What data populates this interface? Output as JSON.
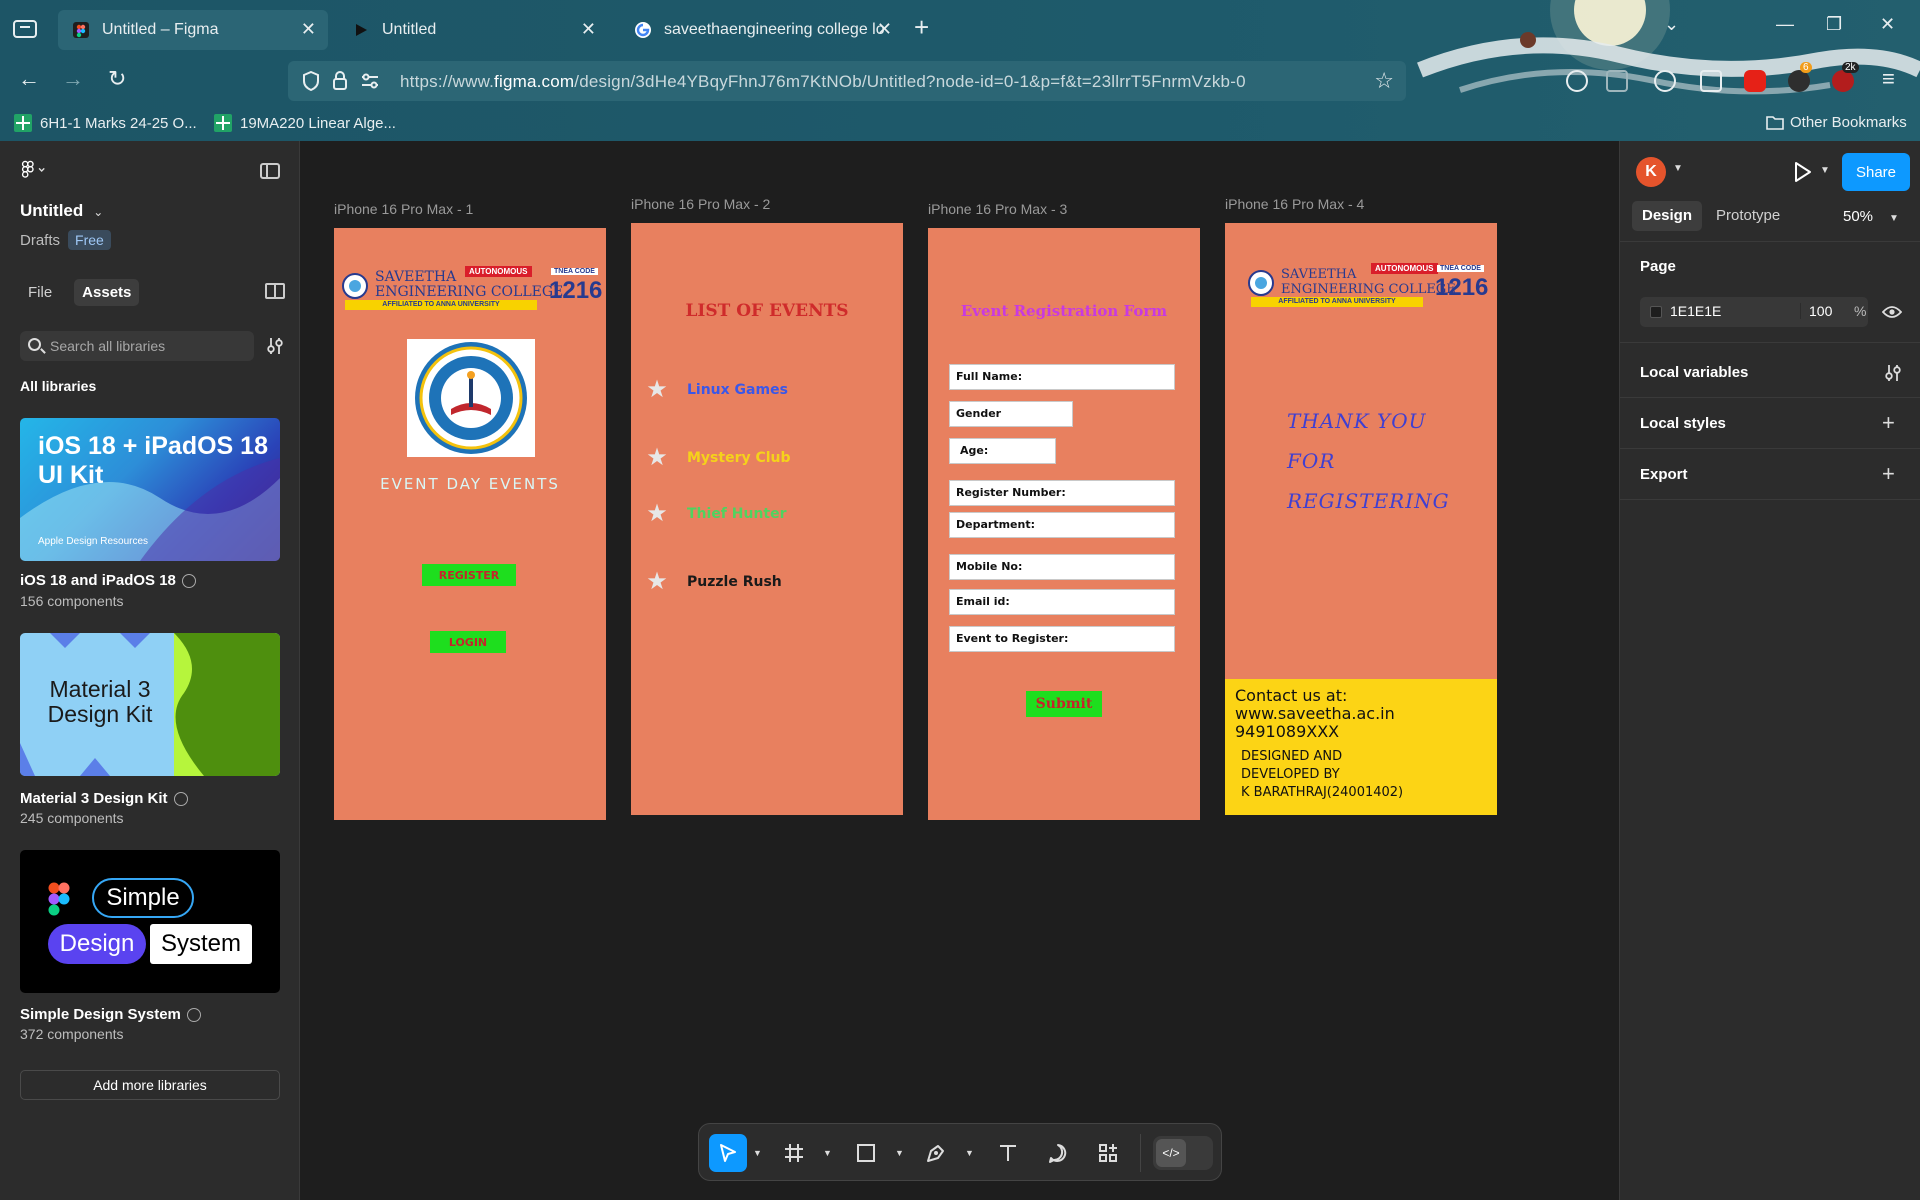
{
  "browser": {
    "tabs": [
      {
        "title": "Untitled – Figma",
        "active": true
      },
      {
        "title": "Untitled",
        "active": false
      },
      {
        "title": "saveethaengineering college lo",
        "active": false
      }
    ],
    "url_prefix": "https://www.",
    "url_domain": "figma.com",
    "url_path": "/design/3dHe4YBqyFhnJ76m7KtNOb/Untitled?node-id=0-1&p=f&t=23llrrT5FnrmVzkb-0",
    "bookmarks": [
      "6H1-1 Marks 24-25 O...",
      "19MA220 Linear Alge..."
    ],
    "other_bookmarks": "Other Bookmarks",
    "ext_badges": {
      "badge1": "6",
      "badge2": "2k"
    }
  },
  "left_panel": {
    "file_name": "Untitled",
    "location": "Drafts",
    "plan_badge": "Free",
    "tabs": [
      "File",
      "Assets"
    ],
    "search_placeholder": "Search all libraries",
    "all_libraries_label": "All libraries",
    "libraries": [
      {
        "name": "iOS 18 and iPadOS 18",
        "count": "156 components",
        "thumb_title": "iOS 18 + iPadOS 18 UI Kit",
        "thumb_sub": "Apple Design Resources"
      },
      {
        "name": "Material 3 Design Kit",
        "count": "245 components",
        "thumb_title": "Material 3 Design Kit"
      },
      {
        "name": "Simple Design System",
        "count": "372 components",
        "thumb_words": [
          "Simple",
          "Design",
          "System"
        ]
      }
    ],
    "add_more": "Add more libraries"
  },
  "canvas": {
    "frames": [
      {
        "label": "iPhone 16 Pro Max - 1"
      },
      {
        "label": "iPhone 16 Pro Max - 2"
      },
      {
        "label": "iPhone 16 Pro Max - 3"
      },
      {
        "label": "iPhone 16 Pro Max - 4"
      }
    ],
    "college": {
      "name_line1": "SAVEETHA",
      "name_line2": "ENGINEERING COLLEGE",
      "autonomous": "AUTONOMOUS",
      "affiliation": "AFFILIATED TO ANNA UNIVERSITY",
      "tnea_label": "TNEA CODE",
      "tnea_code": "1216"
    },
    "frame1": {
      "event_day": "EVENT DAY EVENTS",
      "register": "REGISTER",
      "login": "LOGIN"
    },
    "frame2": {
      "title": "LIST OF EVENTS",
      "events": [
        {
          "name": "Linux Games",
          "color": "#3b57e8"
        },
        {
          "name": "Mystery Club",
          "color": "#f5d21a"
        },
        {
          "name": "Thief Hunter",
          "color": "#4fd35f"
        },
        {
          "name": "Puzzle Rush",
          "color": "#1a1a1a"
        }
      ]
    },
    "frame3": {
      "title": "Event Registration Form",
      "fields": [
        "Full Name:",
        "Gender",
        "Age:",
        "Register Number:",
        "Department:",
        "Mobile No:",
        "Email id:",
        "Event to Register:"
      ],
      "submit": "Submit"
    },
    "frame4": {
      "thank_lines": [
        "THANK YOU",
        "FOR",
        "REGISTERING"
      ],
      "contact_lines": [
        "Contact us at:",
        "www.saveetha.ac.in",
        "9491089XXX"
      ],
      "dev_lines": [
        "DESIGNED AND",
        "DEVELOPED BY",
        "K BARATHRAJ(24001402)"
      ]
    }
  },
  "right_panel": {
    "avatar_initial": "K",
    "share": "Share",
    "tabs": [
      "Design",
      "Prototype"
    ],
    "zoom": "50%",
    "page_heading": "Page",
    "page_color": "1E1E1E",
    "page_opacity": "100",
    "page_pct": "%",
    "sections": [
      "Local variables",
      "Local styles",
      "Export"
    ]
  },
  "toolbar": {
    "help": "?"
  },
  "colors": {
    "accent": "#0d99ff",
    "frame_bg": "#e8805f",
    "canvas_bg": "#1e1e1e",
    "panel_bg": "#2c2c2c",
    "green_btn": "#1ede1e",
    "contact_yellow": "#fcd415"
  }
}
